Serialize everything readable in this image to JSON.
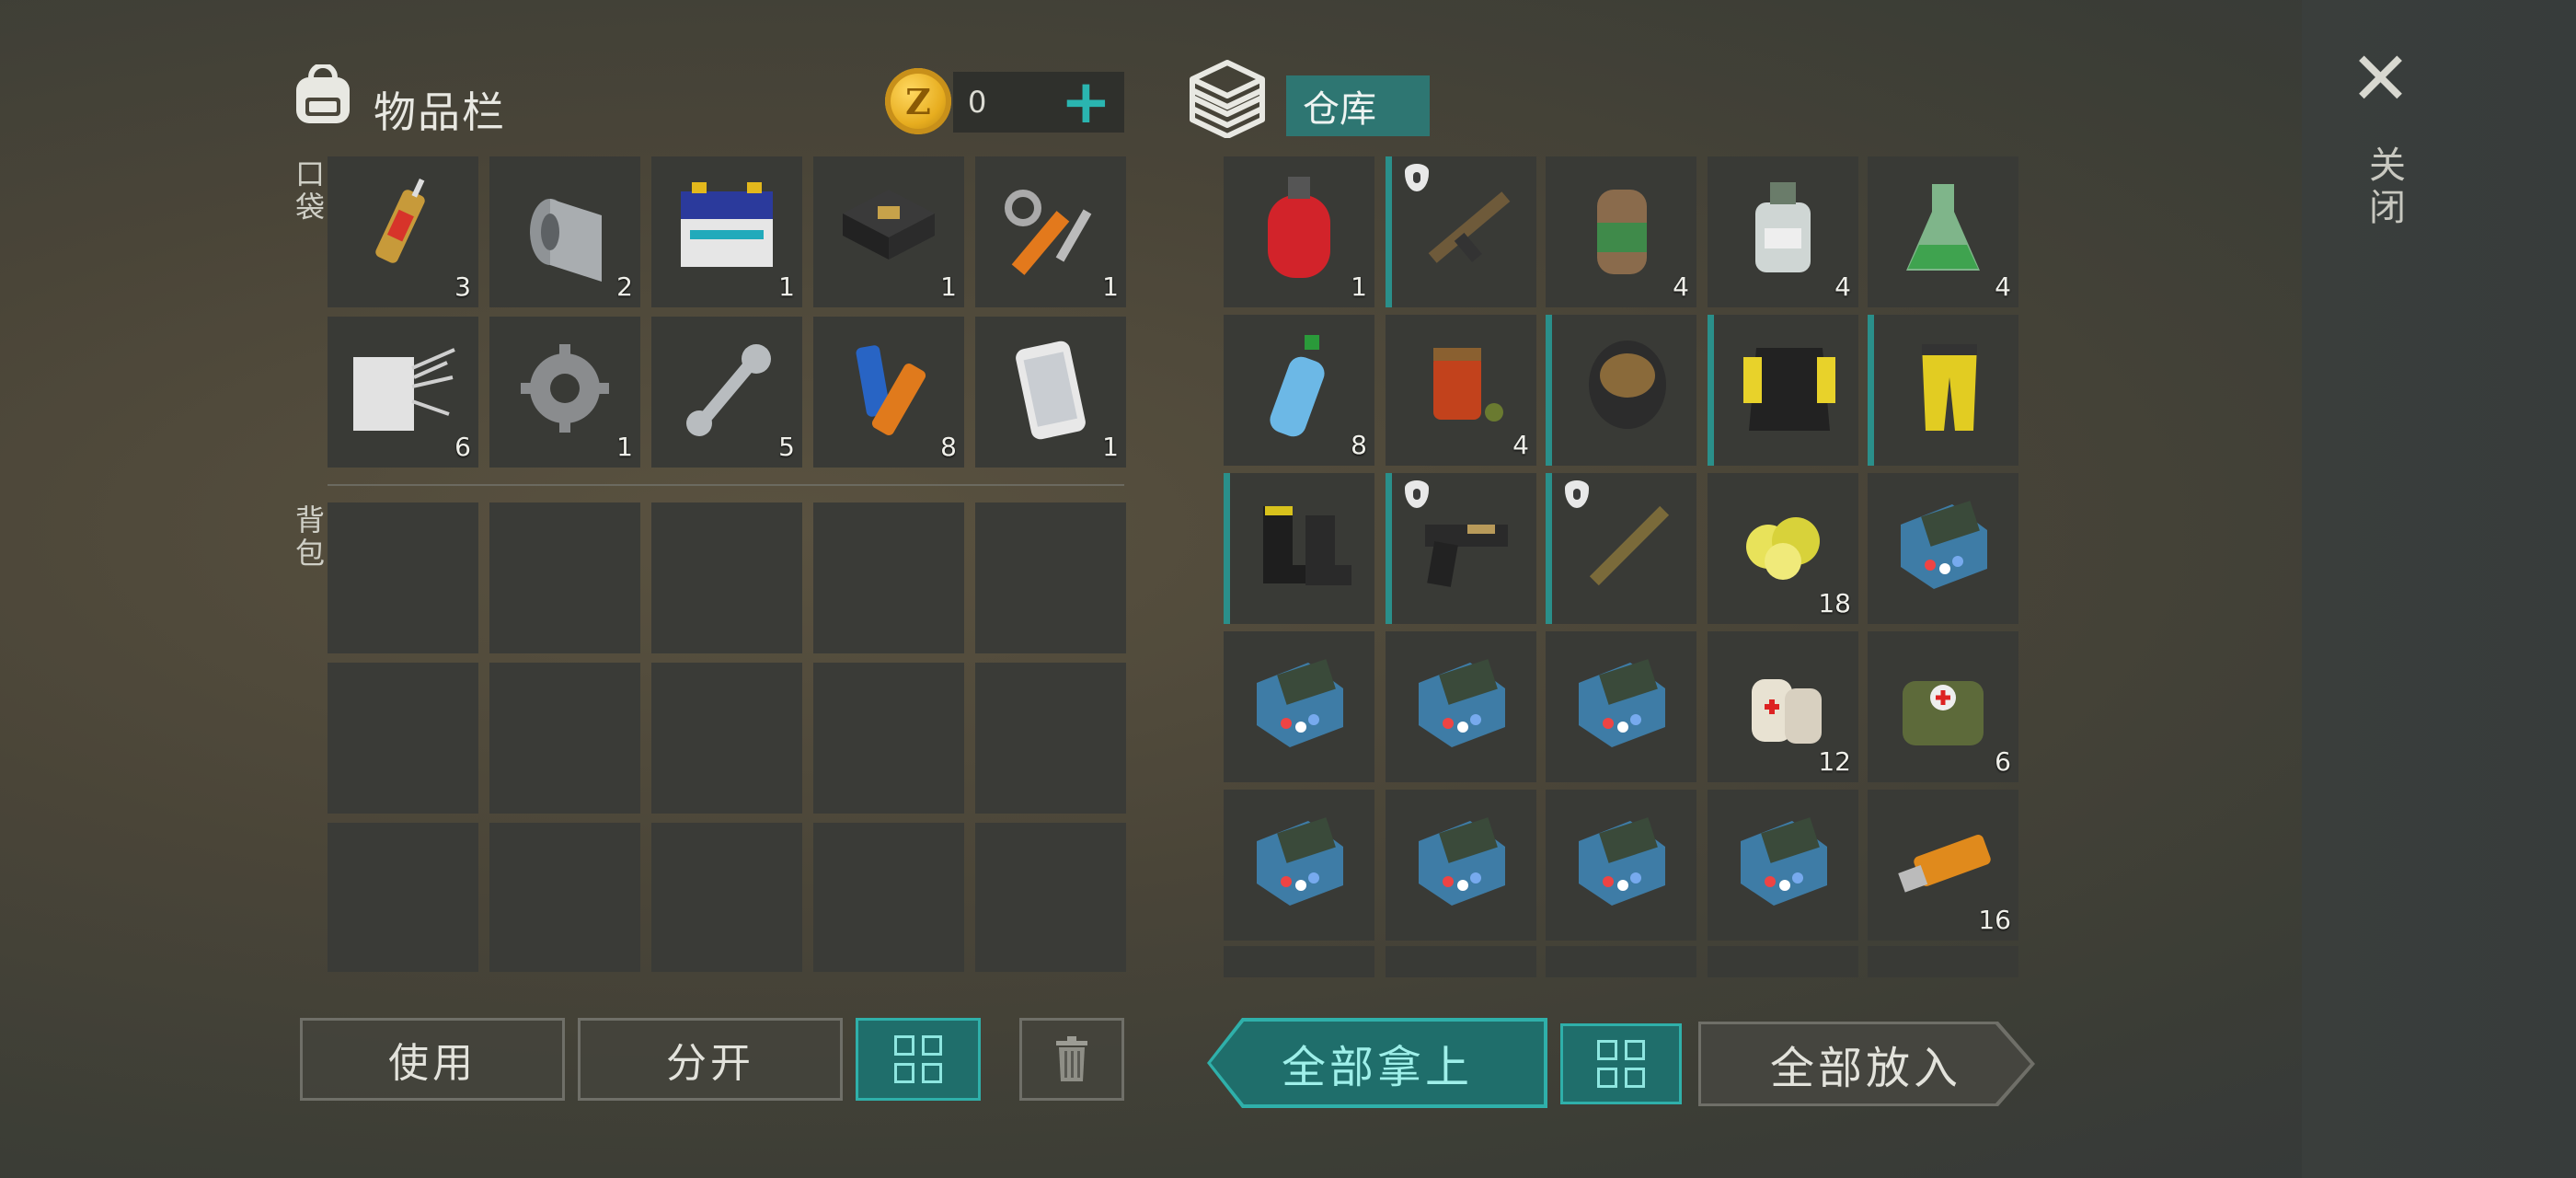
{
  "inventory": {
    "title": "物品栏",
    "coins": "0",
    "coin_symbol": "Z",
    "add_symbol": "+",
    "pocket_label": "口袋",
    "backpack_label": "背包",
    "pocket_counts": [
      "3",
      "2",
      "1",
      "1",
      "1",
      "6",
      "1",
      "5",
      "8",
      "1"
    ],
    "pocket_items": [
      "syringe",
      "metal-roll",
      "battery",
      "circuit-board",
      "hydraulic-parts",
      "fabric-wire",
      "gear",
      "wrench",
      "aa-batteries",
      "smartphone"
    ]
  },
  "storage": {
    "title": "仓库",
    "items": [
      {
        "name": "gas-cylinder",
        "count": "1"
      },
      {
        "name": "assault-rifle",
        "count": "",
        "equip": true,
        "shield": true
      },
      {
        "name": "canister",
        "count": "4"
      },
      {
        "name": "chemical-bottle",
        "count": "4"
      },
      {
        "name": "flask",
        "count": "4"
      },
      {
        "name": "water-bottle",
        "count": "8"
      },
      {
        "name": "spice-jar",
        "count": "4"
      },
      {
        "name": "gas-mask",
        "count": "",
        "equip": true
      },
      {
        "name": "tactical-vest",
        "count": "",
        "equip": true
      },
      {
        "name": "hazmat-pants",
        "count": "",
        "equip": true
      },
      {
        "name": "boots",
        "count": "",
        "equip": true
      },
      {
        "name": "pistol",
        "count": "",
        "equip": true,
        "shield": true
      },
      {
        "name": "shotgun",
        "count": "",
        "equip": true,
        "shield": true
      },
      {
        "name": "sulfur",
        "count": "18"
      },
      {
        "name": "electronics-kit",
        "count": ""
      },
      {
        "name": "electronics-kit",
        "count": ""
      },
      {
        "name": "electronics-kit",
        "count": ""
      },
      {
        "name": "electronics-kit",
        "count": ""
      },
      {
        "name": "bandage",
        "count": "12"
      },
      {
        "name": "medical-bag",
        "count": "6"
      },
      {
        "name": "electronics-kit",
        "count": ""
      },
      {
        "name": "electronics-kit",
        "count": ""
      },
      {
        "name": "electronics-kit",
        "count": ""
      },
      {
        "name": "electronics-kit",
        "count": ""
      },
      {
        "name": "usb-drive",
        "count": "16"
      }
    ]
  },
  "buttons": {
    "use": "使用",
    "split": "分开",
    "take_all": "全部拿上",
    "put_all": "全部放入"
  },
  "close": {
    "symbol": "✕",
    "label": "关闭"
  },
  "colors": {
    "accent": "#2fb0aa",
    "tab": "#2e7672",
    "coin": "#e7ad1f"
  }
}
